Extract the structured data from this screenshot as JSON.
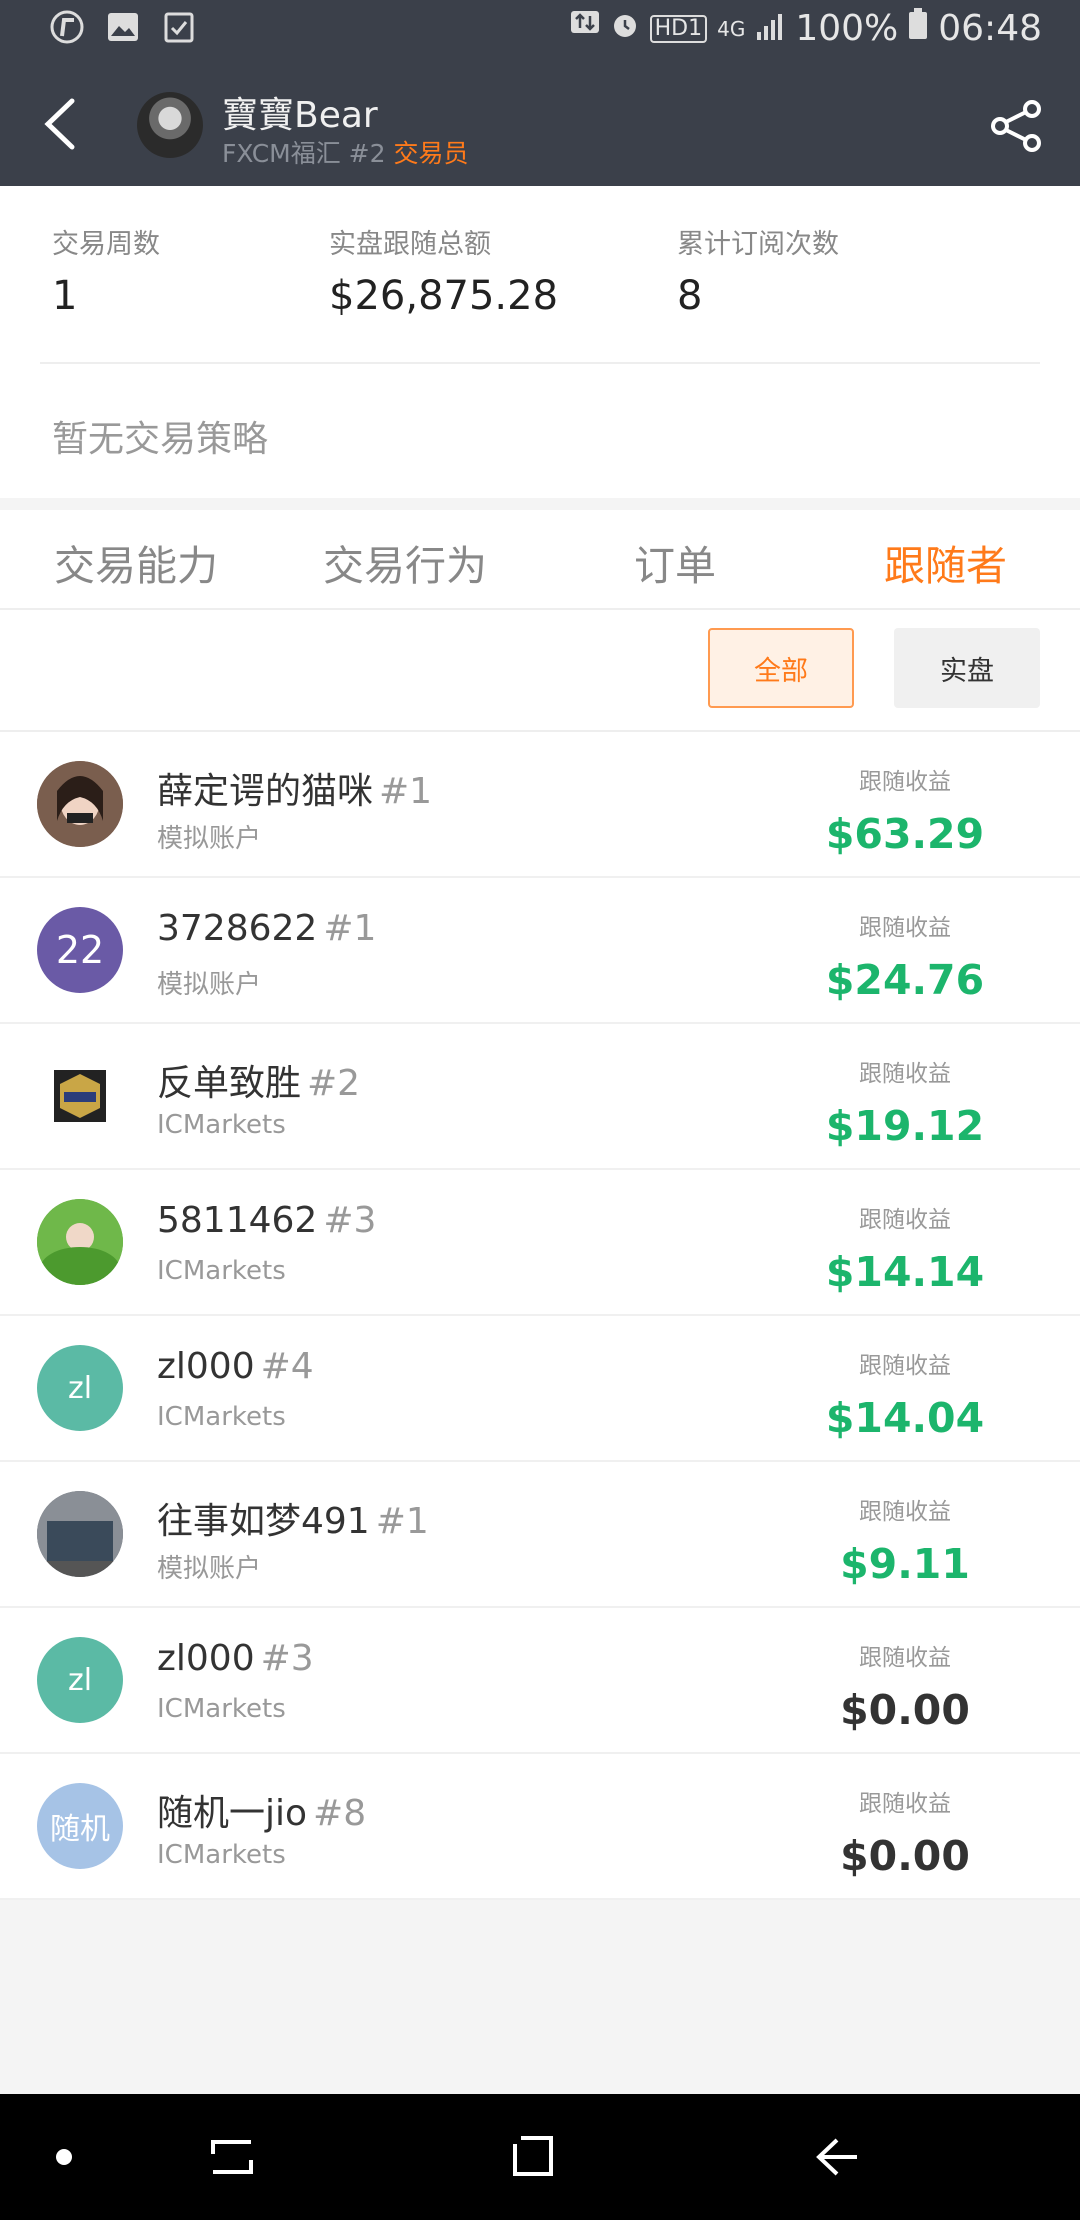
{
  "status_bar": {
    "battery": "100%",
    "time": "06:48",
    "network": "4G",
    "hd": "HD1"
  },
  "header": {
    "name": "寶寶Bear",
    "broker": "FXCM福汇 #2",
    "role": "交易员"
  },
  "stats": [
    {
      "label": "交易周数",
      "value": "1"
    },
    {
      "label": "实盘跟随总额",
      "value": "$26,875.28"
    },
    {
      "label": "累计订阅次数",
      "value": "8"
    }
  ],
  "no_strategy": "暂无交易策略",
  "tabs": [
    "交易能力",
    "交易行为",
    "订单",
    "跟随者"
  ],
  "active_tab": "跟随者",
  "filters": {
    "all": "全部",
    "real": "实盘"
  },
  "followers": [
    {
      "name": "薛定谔的猫咪",
      "rank": "#1",
      "account": "模拟账户",
      "earn_label": "跟随收益",
      "earn": "$63.29",
      "positive": true,
      "avatar_text": "",
      "avatar_color": "#8a6a5a"
    },
    {
      "name": "3728622",
      "rank": "#1",
      "account": "模拟账户",
      "earn_label": "跟随收益",
      "earn": "$24.76",
      "positive": true,
      "avatar_text": "22",
      "avatar_color": "#6a5aa6"
    },
    {
      "name": "反单致胜",
      "rank": "#2",
      "account": "ICMarkets",
      "earn_label": "跟随收益",
      "earn": "$19.12",
      "positive": true,
      "avatar_text": "",
      "avatar_color": "#ffffff"
    },
    {
      "name": "5811462",
      "rank": "#3",
      "account": "ICMarkets",
      "earn_label": "跟随收益",
      "earn": "$14.14",
      "positive": true,
      "avatar_text": "",
      "avatar_color": "#5aa43a"
    },
    {
      "name": "zl000",
      "rank": "#4",
      "account": "ICMarkets",
      "earn_label": "跟随收益",
      "earn": "$14.04",
      "positive": true,
      "avatar_text": "zl",
      "avatar_color": "#5bbaa5"
    },
    {
      "name": "往事如梦491",
      "rank": "#1",
      "account": "模拟账户",
      "earn_label": "跟随收益",
      "earn": "$9.11",
      "positive": true,
      "avatar_text": "",
      "avatar_color": "#5a6068"
    },
    {
      "name": "zl000",
      "rank": "#3",
      "account": "ICMarkets",
      "earn_label": "跟随收益",
      "earn": "$0.00",
      "positive": false,
      "avatar_text": "zl",
      "avatar_color": "#5bbaa5"
    },
    {
      "name": "随机一jio",
      "rank": "#8",
      "account": "ICMarkets",
      "earn_label": "跟随收益",
      "earn": "$0.00",
      "positive": false,
      "avatar_text": "随机",
      "avatar_color": "#a6c3e6"
    }
  ],
  "colors": {
    "accent": "#ff7a1a",
    "positive": "#1cb56c",
    "header_bg": "#3b404a"
  },
  "icons": {
    "back": "back-arrow-icon",
    "share": "share-icon",
    "nav_home": "home-dot-icon",
    "nav_recent": "recent-apps-icon",
    "nav_overview": "overview-icon",
    "nav_back": "nav-back-icon"
  }
}
